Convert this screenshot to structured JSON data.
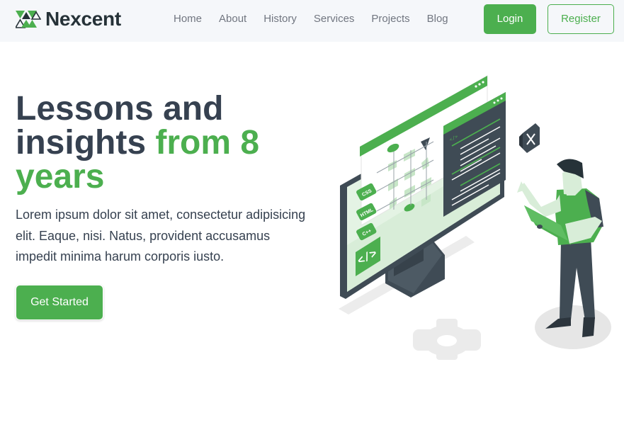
{
  "brand": {
    "name": "Nexcent",
    "icon": "triangle-logo-icon",
    "accent_color": "#4caf4f"
  },
  "nav": {
    "links": [
      "Home",
      "About",
      "History",
      "Services",
      "Projects",
      "Blog"
    ],
    "login_label": "Login",
    "register_label": "Register"
  },
  "hero": {
    "title_main": "Lessons and insights ",
    "title_accent": "from 8 years",
    "description": "Lorem ipsum dolor sit amet, consectetur adipisicing elit. Eaque, nisi. Natus, provident accusamus impedit minima harum corporis iusto.",
    "cta_label": "Get Started",
    "illustration": {
      "icon": "developer-at-monitor-illustration",
      "badges": [
        "CSS",
        "HTML",
        "C++"
      ]
    }
  }
}
